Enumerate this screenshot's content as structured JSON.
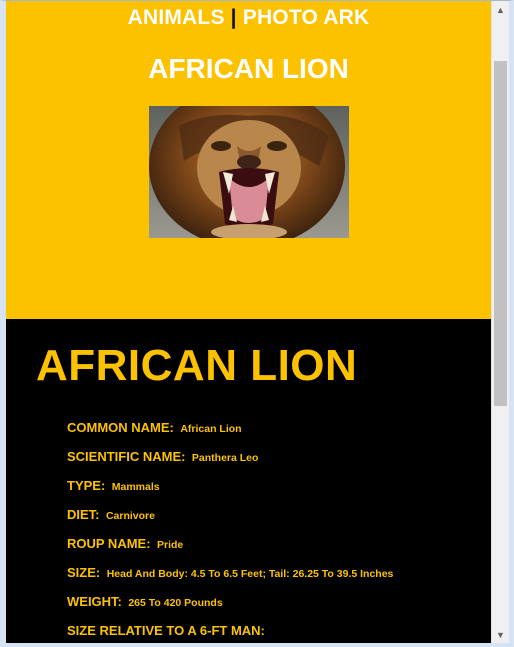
{
  "nav": {
    "left": "ANIMALS",
    "separator": "|",
    "right": "PHOTO ARK"
  },
  "hero": {
    "title": "AFRICAN LION",
    "color": "#fcc200"
  },
  "info": {
    "title": "AFRICAN LION",
    "facts": [
      {
        "label": "COMMON NAME:",
        "value": "African Lion"
      },
      {
        "label": "SCIENTIFIC NAME:",
        "value": "Panthera Leo"
      },
      {
        "label": "TYPE:",
        "value": "Mammals"
      },
      {
        "label": "DIET:",
        "value": "Carnivore"
      },
      {
        "label": "ROUP NAME:",
        "value": "Pride"
      },
      {
        "label": "SIZE:",
        "value": "Head And Body: 4.5 To 6.5 Feet; Tail: 26.25 To 39.5 Inches"
      },
      {
        "label": "WEIGHT:",
        "value": "265 To 420 Pounds"
      },
      {
        "label": "SIZE RELATIVE TO A 6-FT MAN:",
        "value": ""
      }
    ]
  },
  "scrollbar": {
    "up_icon": "▲",
    "down_icon": "▼"
  }
}
